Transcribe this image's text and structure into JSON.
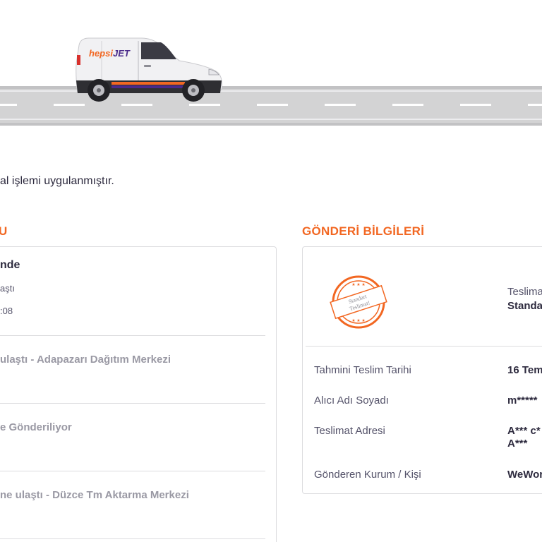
{
  "hero": {
    "van_brand": "hepsiJET",
    "van_brand_parts": {
      "first": "hepsi",
      "second": "JET"
    },
    "brand_colors": {
      "orange": "#f26722",
      "purple": "#4a2a8a"
    }
  },
  "notice": "al işlemi uygulanmıştır.",
  "tracking": {
    "section_title": "U",
    "current_status": {
      "title": "nde",
      "subtitle": "aştı",
      "time": ":08"
    },
    "history": [
      {
        "text": "ulaştı - Adapazarı Dağıtım Merkezi"
      },
      {
        "text": "e Gönderiliyor"
      },
      {
        "text": "ne ulaştı - Düzce Tm Aktarma Merkezi"
      }
    ]
  },
  "shipment": {
    "section_title": "GÖNDERİ BİLGİLERİ",
    "stamp_text": {
      "line1": "Standart",
      "line2": "Teslimat!"
    },
    "delivery_type_label": "Teslima",
    "delivery_type_value": "Standa",
    "rows": [
      {
        "label": "Tahmini Teslim Tarihi",
        "value": "16 Tem"
      },
      {
        "label": "Alıcı Adı Soyadı",
        "value": "m*****"
      },
      {
        "label": "Teslimat Adresi",
        "value": "A*** c*",
        "value2": "A***"
      },
      {
        "label": "Gönderen Kurum / Kişi",
        "value": "WeWor"
      }
    ]
  }
}
